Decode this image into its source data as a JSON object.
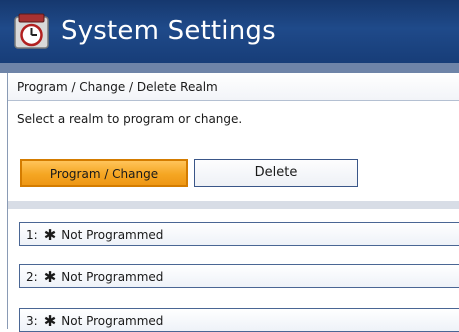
{
  "window": {
    "title": "System Settings"
  },
  "breadcrumb": "Program / Change / Delete Realm",
  "instruction": "Select a realm to program or change.",
  "buttons": {
    "program_change": "Program / Change",
    "delete": "Delete"
  },
  "realms": [
    {
      "number": "1:",
      "marker": "✱",
      "status": "Not Programmed"
    },
    {
      "number": "2:",
      "marker": "✱",
      "status": "Not Programmed"
    },
    {
      "number": "3:",
      "marker": "✱",
      "status": "Not Programmed"
    }
  ],
  "colors": {
    "titlebar": "#1f4a8a",
    "selected_button": "#f5a623",
    "border_accent": "#3a5688"
  },
  "icons": {
    "title_icon": "settings-clock-icon"
  }
}
